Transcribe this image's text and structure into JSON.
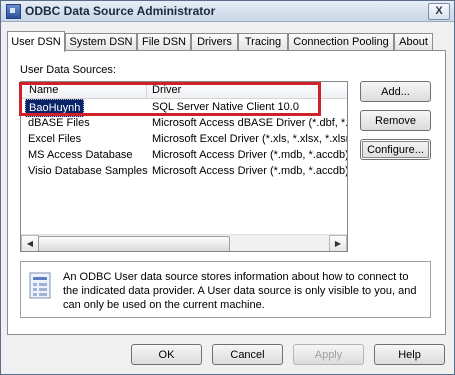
{
  "window": {
    "title": "ODBC Data Source Administrator",
    "icon": "odbc-app-icon",
    "close_glyph": "X"
  },
  "tabs": [
    {
      "label": "User DSN",
      "active": true
    },
    {
      "label": "System DSN"
    },
    {
      "label": "File DSN"
    },
    {
      "label": "Drivers"
    },
    {
      "label": "Tracing"
    },
    {
      "label": "Connection Pooling"
    },
    {
      "label": "About"
    }
  ],
  "user_dsn": {
    "section_label": "User Data Sources:",
    "columns": [
      "Name",
      "Driver"
    ],
    "rows": [
      {
        "name": "BaoHuynh",
        "driver": "SQL Server Native Client 10.0",
        "selected": true
      },
      {
        "name": "dBASE Files",
        "driver": "Microsoft Access dBASE Driver (*.dbf, *.nd"
      },
      {
        "name": "Excel Files",
        "driver": "Microsoft Excel Driver (*.xls, *.xlsx, *.xlsm,"
      },
      {
        "name": "MS Access Database",
        "driver": "Microsoft Access Driver (*.mdb, *.accdb)"
      },
      {
        "name": "Visio Database Samples",
        "driver": "Microsoft Access Driver (*.mdb, *.accdb)"
      }
    ],
    "scroll_left": "◀",
    "scroll_right": "▶",
    "buttons": {
      "add": "Add...",
      "remove": "Remove",
      "configure": "Configure..."
    },
    "info_text": "An ODBC User data source stores information about how to connect to the indicated data provider.   A User data source is only visible to you, and can only be used on the current machine."
  },
  "footer": {
    "ok": "OK",
    "cancel": "Cancel",
    "apply": "Apply",
    "help": "Help"
  },
  "colors": {
    "highlight": "#d0202a",
    "selection": "#0a246a"
  }
}
